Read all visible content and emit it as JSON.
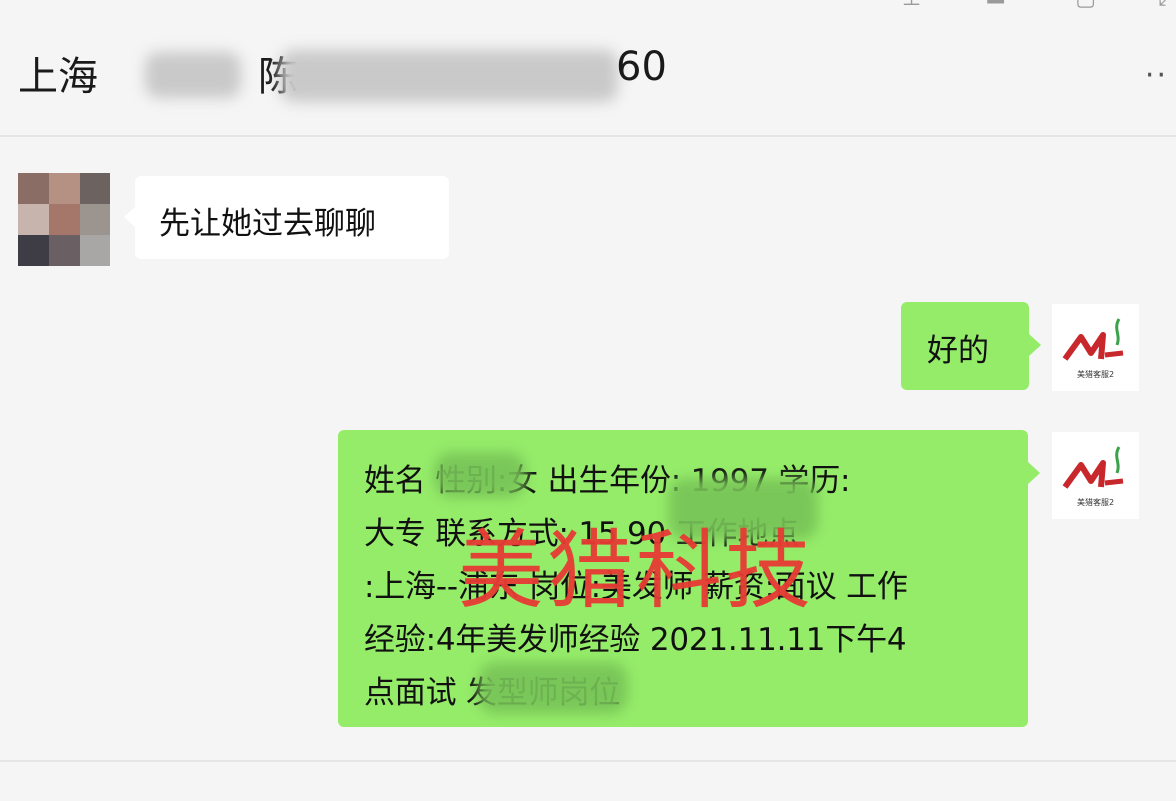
{
  "header": {
    "title_prefix": "上海",
    "title_mid": "陈",
    "title_suffix": "60",
    "more_label": "··"
  },
  "window_controls": [
    "pin-icon",
    "minimize-icon",
    "maximize-icon",
    "close-icon"
  ],
  "messages": [
    {
      "side": "left",
      "text": "先让她过去聊聊"
    },
    {
      "side": "right",
      "text": "好的"
    },
    {
      "side": "right",
      "lines": [
        "姓名            性别:女 出生年份: 1997 学历:",
        "大专 联系方式: 15              90 工作地点",
        ":上海--浦东 岗位:美发师 薪资:面议 工作",
        "经验:4年美发师经验 2021.11.11下午4",
        "点面试                      发型师岗位"
      ]
    }
  ],
  "avatar_right_caption": "美猎客服2",
  "watermark": "美猎科技",
  "colors": {
    "bubble_green": "#95ec69",
    "bubble_white": "#ffffff",
    "background": "#f5f5f5",
    "watermark_red": "#e83b34"
  }
}
